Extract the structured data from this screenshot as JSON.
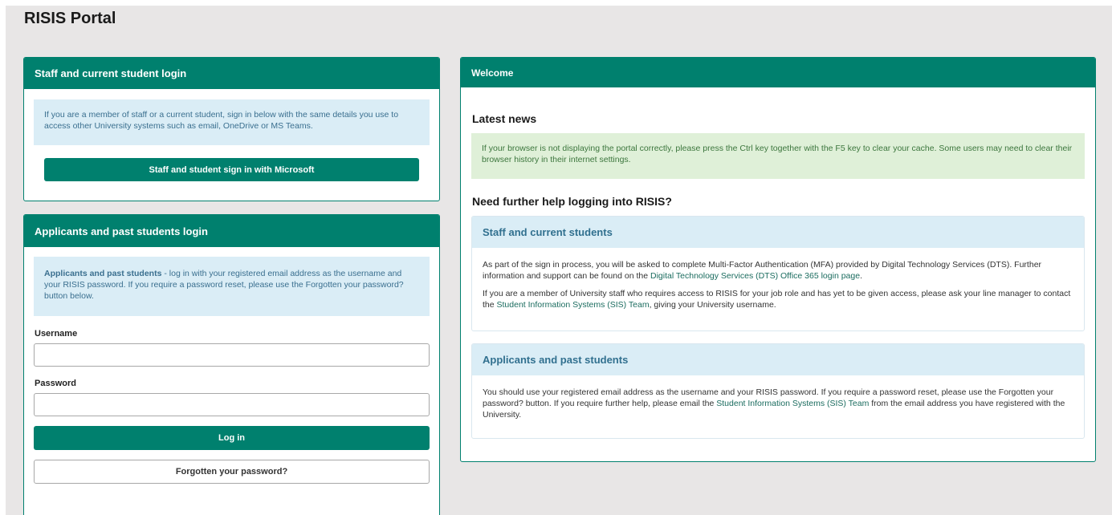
{
  "page": {
    "title": "RISIS Portal"
  },
  "staff_login": {
    "header": "Staff and current student login",
    "info": "If you are a member of staff or a current student, sign in below with the same details you use to access other University systems such as email, OneDrive or MS Teams.",
    "sign_in_button": "Staff and student sign in with Microsoft"
  },
  "applicant_login": {
    "header": "Applicants and past students login",
    "info_bold": "Applicants and past students",
    "info_rest": " - log in with your registered email address as the username and your RISIS password. If you require a password reset, please use the Forgotten your password? button below.",
    "username_label": "Username",
    "username_value": "",
    "password_label": "Password",
    "password_value": "",
    "login_button": "Log in",
    "forgot_button": "Forgotten your password?"
  },
  "welcome": {
    "header": "Welcome",
    "latest_news_heading": "Latest news",
    "news_text": "If your browser is not displaying the portal correctly, please press the Ctrl key together with the F5 key to clear your cache. Some users may need to clear their browser history in their internet settings.",
    "help_heading": "Need further help logging into RISIS?",
    "staff_card": {
      "title": "Staff and current students",
      "p1_before": "As part of the sign in process, you will be asked to complete Multi-Factor Authentication (MFA) provided by Digital Technology Services (DTS). Further information and support can be found on the ",
      "p1_link": "Digital Technology Services (DTS) Office 365 login page",
      "p1_after": ".",
      "p2_before": "If you are a member of University staff who requires access to RISIS for your job role and has yet to be given access, please ask your line manager to contact the ",
      "p2_link": "Student Information Systems (SIS) Team",
      "p2_after": ", giving your University username."
    },
    "applicant_card": {
      "title": "Applicants and past students",
      "p1_before": "You should use your registered email address as the username and your RISIS password. If you require a password reset, please use the Forgotten your password? button. If you require further help, please email the ",
      "p1_link": "Student Information Systems (SIS) Team",
      "p1_after": " from the email address you have registered with the University."
    }
  },
  "colors": {
    "primary": "#00806e",
    "info_bg": "#daedf6",
    "success_bg": "#dff0d8",
    "page_bg": "#e8e6e6"
  }
}
